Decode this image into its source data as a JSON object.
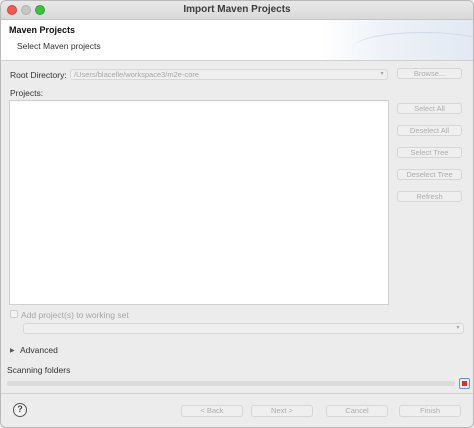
{
  "window": {
    "title": "Import Maven Projects"
  },
  "header": {
    "title": "Maven Projects",
    "subtitle": "Select Maven projects"
  },
  "root_directory": {
    "label": "Root Directory:",
    "value": "/Users/blacelle/workspace3/m2e-core",
    "browse_label": "Browse..."
  },
  "projects": {
    "label": "Projects:",
    "buttons": {
      "select_all": "Select All",
      "deselect_all": "Deselect All",
      "select_tree": "Select Tree",
      "deselect_tree": "Deselect Tree",
      "refresh": "Refresh"
    }
  },
  "working_set": {
    "label": "Add project(s) to working set",
    "checked": false,
    "value": ""
  },
  "advanced": {
    "label": "Advanced",
    "expanded": false
  },
  "status": {
    "text": "Scanning folders",
    "progress": 0
  },
  "footer": {
    "back": "< Back",
    "next": "Next >",
    "cancel": "Cancel",
    "finish": "Finish"
  },
  "icons": {
    "help": "help-icon",
    "disclosure": "triangle-right-icon",
    "combo": "chevron-down-icon",
    "stop": "stop-icon"
  },
  "colors": {
    "close": "#ee5b55",
    "minimize": "#c6c6c6",
    "maximize": "#3fbe45",
    "stop": "#d8332b"
  }
}
